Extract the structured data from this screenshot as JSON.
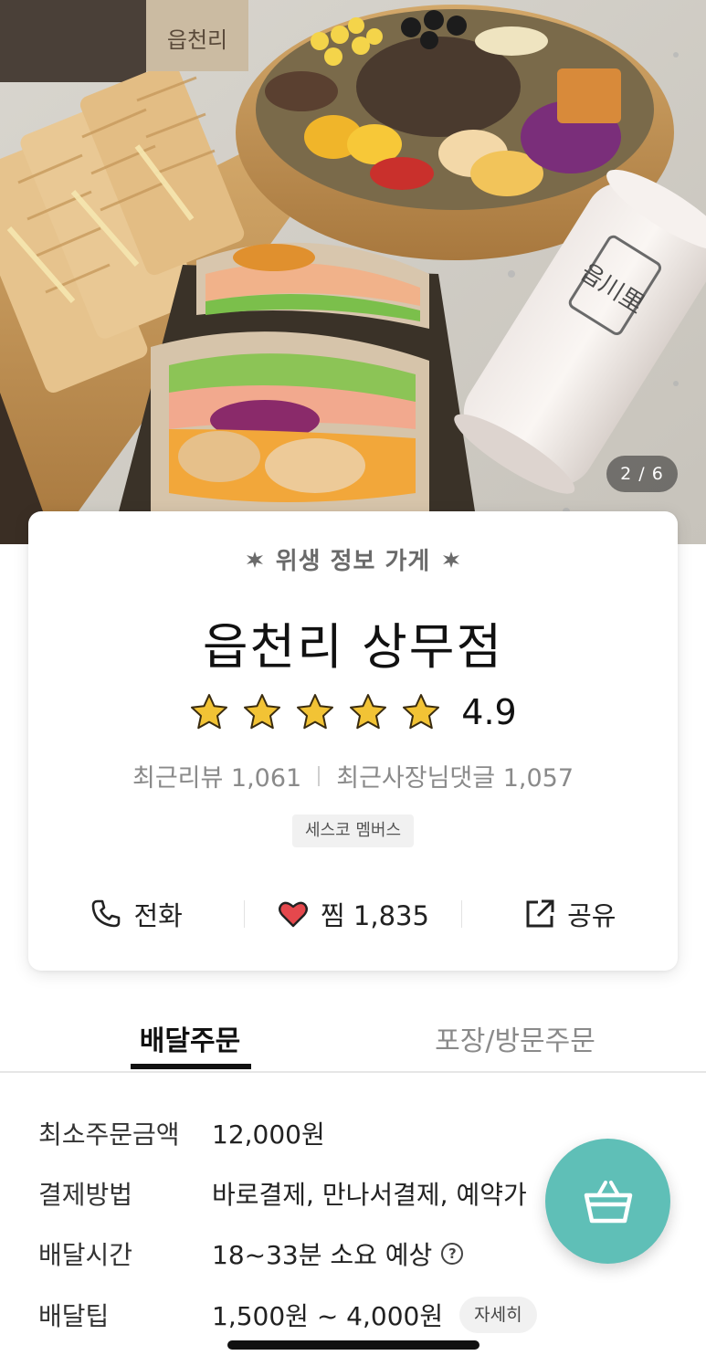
{
  "hero": {
    "image_desc": "photo of sandwiches, waffles, a salad bowl and a drink cup",
    "counter": "2 / 6",
    "cup_logo_top": "읍천리",
    "cup_logo_side": "읍川里"
  },
  "card": {
    "hygiene_label": "위생 정보 가게",
    "store_name": "읍천리 상무점",
    "rating": {
      "value": "4.9",
      "stars": 5,
      "star_color": "#f2c335"
    },
    "reviews": {
      "recent_review": "최근리뷰 1,061",
      "owner_reply": "최근사장님댓글 1,057"
    },
    "badge": "세스코 멤버스",
    "actions": {
      "call": "전화",
      "favorite": "찜 1,835",
      "share": "공유"
    },
    "heart_color": "#e5484d"
  },
  "tabs": {
    "delivery": "배달주문",
    "pickup": "포장/방문주문"
  },
  "delivery_info": {
    "min_order_label": "최소주문금액",
    "min_order_value": "12,000원",
    "payment_label": "결제방법",
    "payment_value": "바로결제, 만나서결제, 예약가",
    "time_label": "배달시간",
    "time_value": "18~33분 소요 예상",
    "tip_label": "배달팁",
    "tip_value": "1,500원 ~ 4,000원",
    "tip_detail": "자세히"
  },
  "cart": {
    "icon": "basket-icon",
    "color": "#5fbfb7"
  }
}
